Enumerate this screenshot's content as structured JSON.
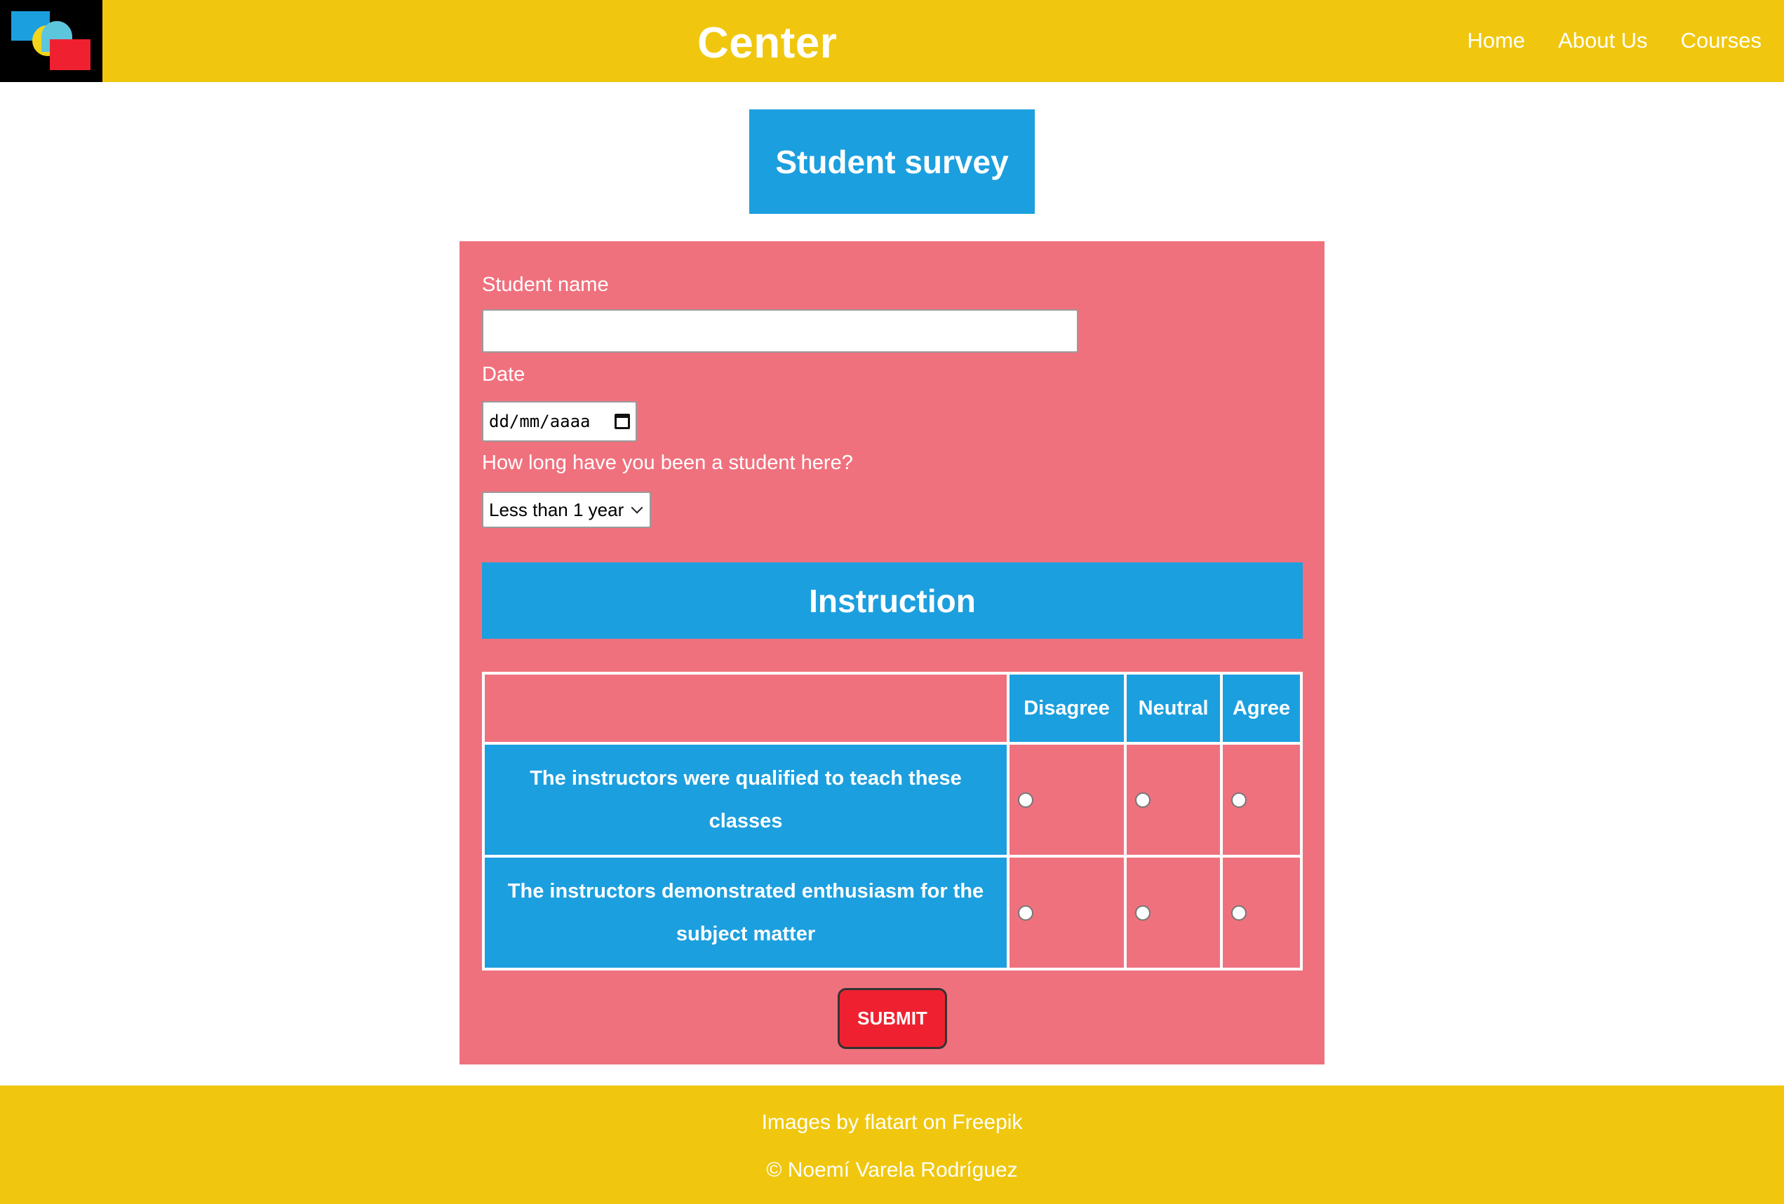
{
  "header": {
    "site_title": "Center",
    "nav": [
      "Home",
      "About Us",
      "Courses"
    ]
  },
  "survey": {
    "title": "Student survey",
    "fields": {
      "name_label": "Student name",
      "name_value": "",
      "date_label": "Date",
      "date_placeholder": "dd/mm/aaaa",
      "duration_label": "How long have you been a student here?",
      "duration_selected": "Less than 1 year"
    },
    "section_title": "Instruction",
    "table": {
      "columns": [
        "Disagree",
        "Neutral",
        "Agree"
      ],
      "questions": [
        "The instructors were qualified to teach these classes",
        "The instructors demonstrated enthusiasm for the subject matter"
      ]
    },
    "submit_label": "SUBMIT"
  },
  "footer": {
    "credit": "Images by flatart on Freepik",
    "copyright": "© Noemí Varela Rodríguez"
  },
  "colors": {
    "header_footer": "#f0c70e",
    "accent_blue": "#1c9fde",
    "panel_pink": "#f0717e",
    "submit_red": "#ef2130"
  }
}
